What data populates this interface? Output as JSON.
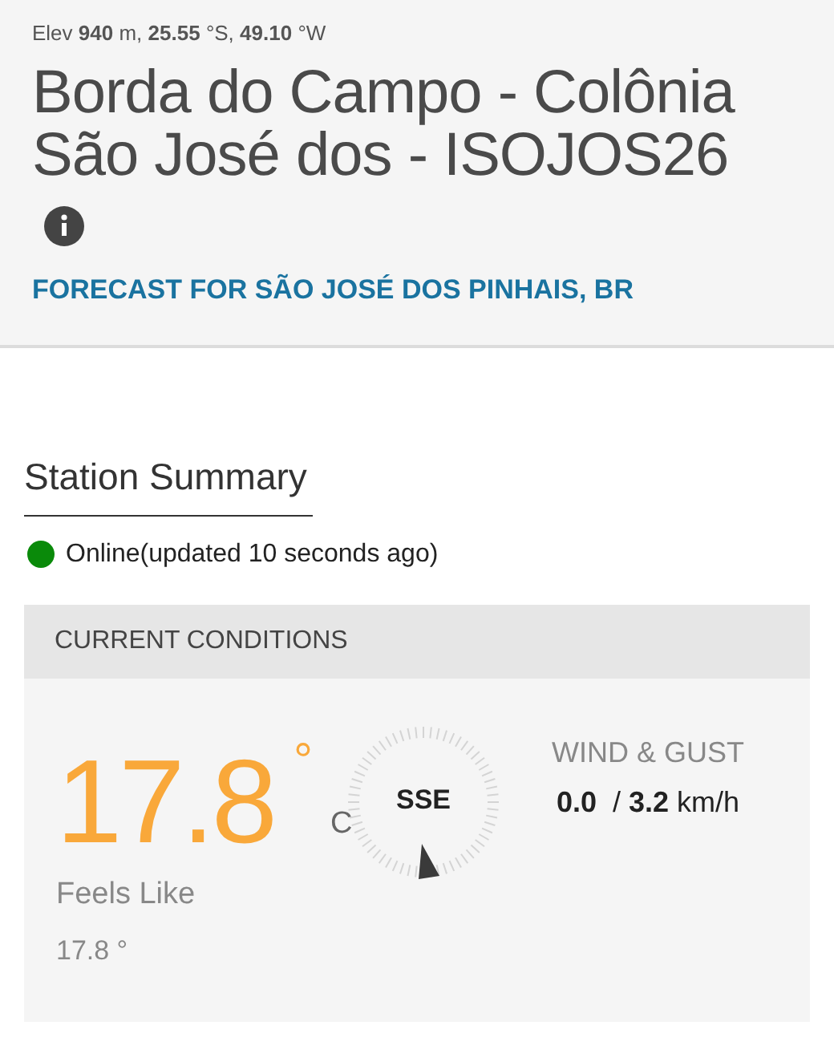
{
  "header": {
    "elevation": "Elev **940** m, **25.55** °S, **49.10** °W",
    "title": "Borda do Campo - Colônia São José dos - ISOJOS26",
    "forecast_link": "FORECAST FOR SÃO JOSÉ DOS PINHAIS, BR"
  },
  "summary": {
    "heading": "Station Summary",
    "status": {
      "online": true,
      "text": "Online(updated 10 seconds ago)"
    }
  },
  "current_conditions": {
    "heading": "CURRENT CONDITIONS",
    "temperature": "17.8",
    "degree": "°",
    "unit": "C",
    "feels_like_label": "Feels Like",
    "feels_like": "17.8 °",
    "wind_direction": "SSE",
    "wind_label": "WIND & GUST",
    "wind_value": "**0.0**  / **3.2** km/h"
  }
}
